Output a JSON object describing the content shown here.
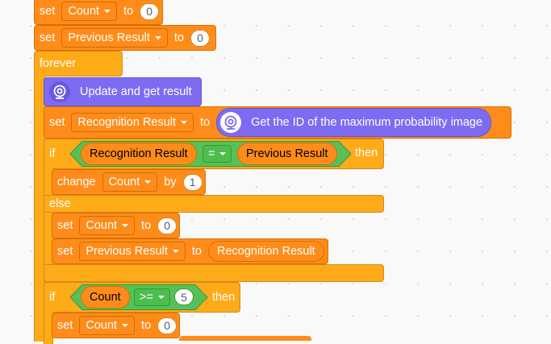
{
  "blocks": {
    "set_count": {
      "keyword": "set",
      "variable": "Count",
      "to": "to",
      "value": "0"
    },
    "set_previous": {
      "keyword": "set",
      "variable": "Previous Result",
      "to": "to",
      "value": "0"
    },
    "forever": {
      "label": "forever"
    },
    "update": {
      "label": "Update and get result",
      "icon": "webcam-icon"
    },
    "set_recognition": {
      "keyword": "set",
      "variable": "Recognition Result",
      "to": "to",
      "reporter": "Get the ID of the maximum probability image",
      "icon": "webcam-icon"
    },
    "if1": {
      "keyword": "if",
      "left": "Recognition Result",
      "operator": "=",
      "right": "Previous Result",
      "then": "then"
    },
    "change_count": {
      "keyword": "change",
      "variable": "Count",
      "by": "by",
      "value": "1"
    },
    "else": {
      "label": "else"
    },
    "set_count2": {
      "keyword": "set",
      "variable": "Count",
      "to": "to",
      "value": "0"
    },
    "set_previous2": {
      "keyword": "set",
      "variable": "Previous Result",
      "to": "to",
      "reporter": "Recognition Result"
    },
    "if2": {
      "keyword": "if",
      "left": "Count",
      "operator": ">=",
      "value": "5",
      "then": "then"
    },
    "set_count3": {
      "keyword": "set",
      "variable": "Count",
      "to": "to",
      "value": "0"
    }
  },
  "colors": {
    "variables": "#ff8c1a",
    "control": "#ffab19",
    "extension": "#7d6bf2",
    "operators": "#59c059",
    "canvas": "#f9f9f9"
  }
}
